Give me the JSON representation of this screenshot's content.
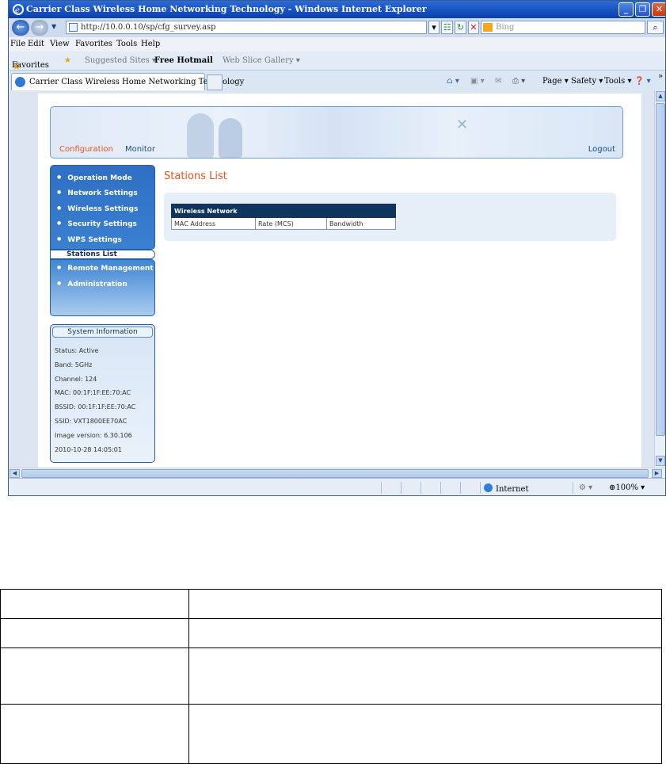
{
  "browser": {
    "window_title": "Carrier Class Wireless Home Networking Technology - Windows Internet Explorer",
    "url": "http://10.0.0.10/sp/cfg_survey.asp",
    "search_placeholder": "Bing",
    "menu": [
      "File",
      "Edit",
      "View",
      "Favorites",
      "Tools",
      "Help"
    ],
    "favorites_label": "Favorites",
    "fav_links": [
      "Suggested Sites ▾",
      "Free Hotmail",
      "Web Slice Gallery ▾"
    ],
    "tab_title": "Carrier Class Wireless Home Networking Technology",
    "commands": [
      "Page ▾",
      "Safety ▾",
      "Tools ▾"
    ],
    "status_zone": "Internet",
    "zoom": "100%"
  },
  "header": {
    "nav_configuration": "Configuration",
    "nav_monitor": "Monitor",
    "logout": "Logout"
  },
  "sidebar": {
    "items": [
      {
        "label": "Operation Mode"
      },
      {
        "label": "Network Settings"
      },
      {
        "label": "Wireless Settings"
      },
      {
        "label": "Security Settings"
      },
      {
        "label": "WPS Settings"
      }
    ],
    "selected": "Stations List",
    "items_bottom": [
      {
        "label": "Remote Management"
      },
      {
        "label": "Administration"
      }
    ]
  },
  "system_info": {
    "title": "System Information",
    "lines": [
      "Status: Active",
      "Band: 5GHz",
      "Channel: 124",
      "MAC: 00:1F:1F:EE:70:AC",
      "BSSID: 00:1F:1F:EE:70:AC",
      "SSID: VXT1800EE70AC",
      "Image version: 6.30.106",
      "2010-10-28 14:05:01"
    ]
  },
  "content": {
    "title": "Stations List",
    "table_header": "Wireless Network",
    "columns": [
      "MAC Address",
      "Rate (MCS)",
      "Bandwidth"
    ]
  }
}
